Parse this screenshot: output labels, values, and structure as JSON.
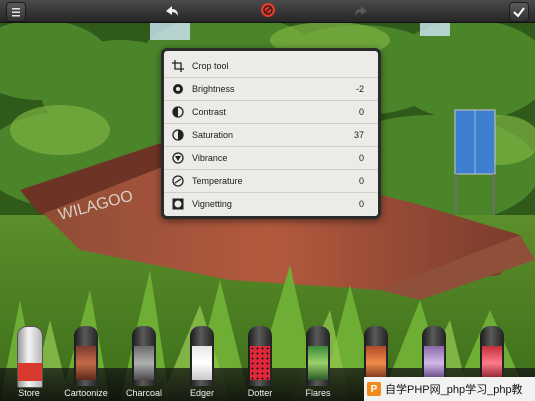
{
  "menu": {
    "items": [
      {
        "label": "Crop tool",
        "value": ""
      },
      {
        "label": "Brightness",
        "value": "-2"
      },
      {
        "label": "Contrast",
        "value": "0"
      },
      {
        "label": "Saturation",
        "value": "37"
      },
      {
        "label": "Vibrance",
        "value": "0"
      },
      {
        "label": "Temperature",
        "value": "0"
      },
      {
        "label": "Vignetting",
        "value": "0"
      }
    ]
  },
  "filters": [
    "Store",
    "Cartoonize",
    "Charcoal",
    "Edger",
    "Dotter",
    "Flares"
  ],
  "watermark": {
    "logo": "P",
    "text": "自学PHP网_php学习_php教"
  },
  "colors": {
    "panel": "#ecebe7",
    "accent": "#e23b2e"
  }
}
